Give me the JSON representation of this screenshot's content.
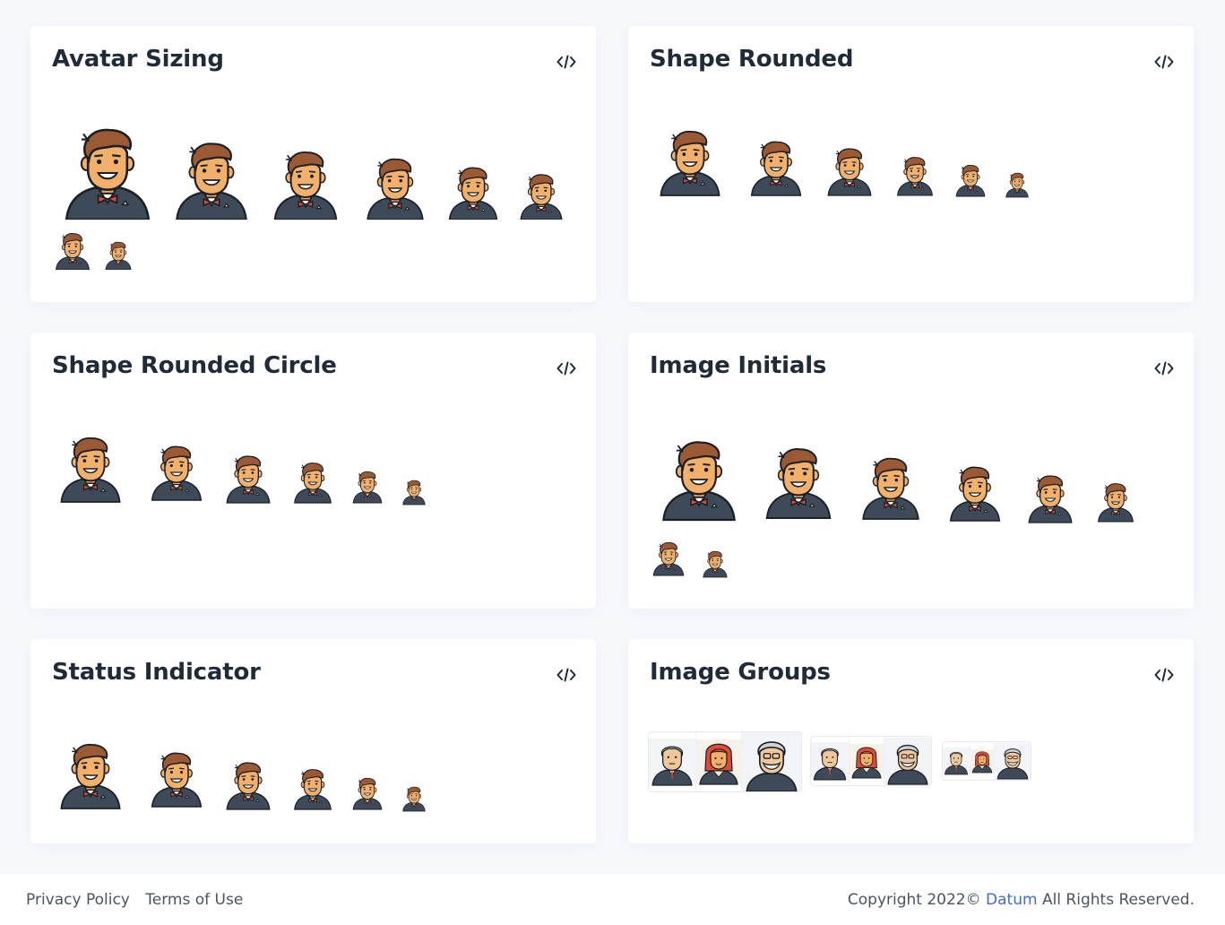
{
  "cards": {
    "avatar_sizing": {
      "title": "Avatar Sizing"
    },
    "shape_rounded": {
      "title": "Shape Rounded"
    },
    "shape_rounded_circle": {
      "title": "Shape Rounded Circle"
    },
    "image_initials": {
      "title": "Image Initials"
    },
    "status_indicator": {
      "title": "Status Indicator"
    },
    "image_groups": {
      "title": "Image Groups"
    }
  },
  "icons": {
    "code": "code-icon",
    "avatar": "man-avatar-icon",
    "woman": "woman-avatar-icon",
    "elder": "elder-avatar-icon"
  },
  "colors": {
    "accent": "#3f6ad8",
    "suit": "#3e4a57",
    "skin": "#f2b06a",
    "hair": "#9b5a33",
    "tie": "#e14b33"
  },
  "footer": {
    "privacy": "Privacy Policy",
    "terms": "Terms of Use",
    "copyright_prefix": "Copyright 2022©",
    "brand": "Datum",
    "copyright_suffix": "All Rights Reserved."
  }
}
